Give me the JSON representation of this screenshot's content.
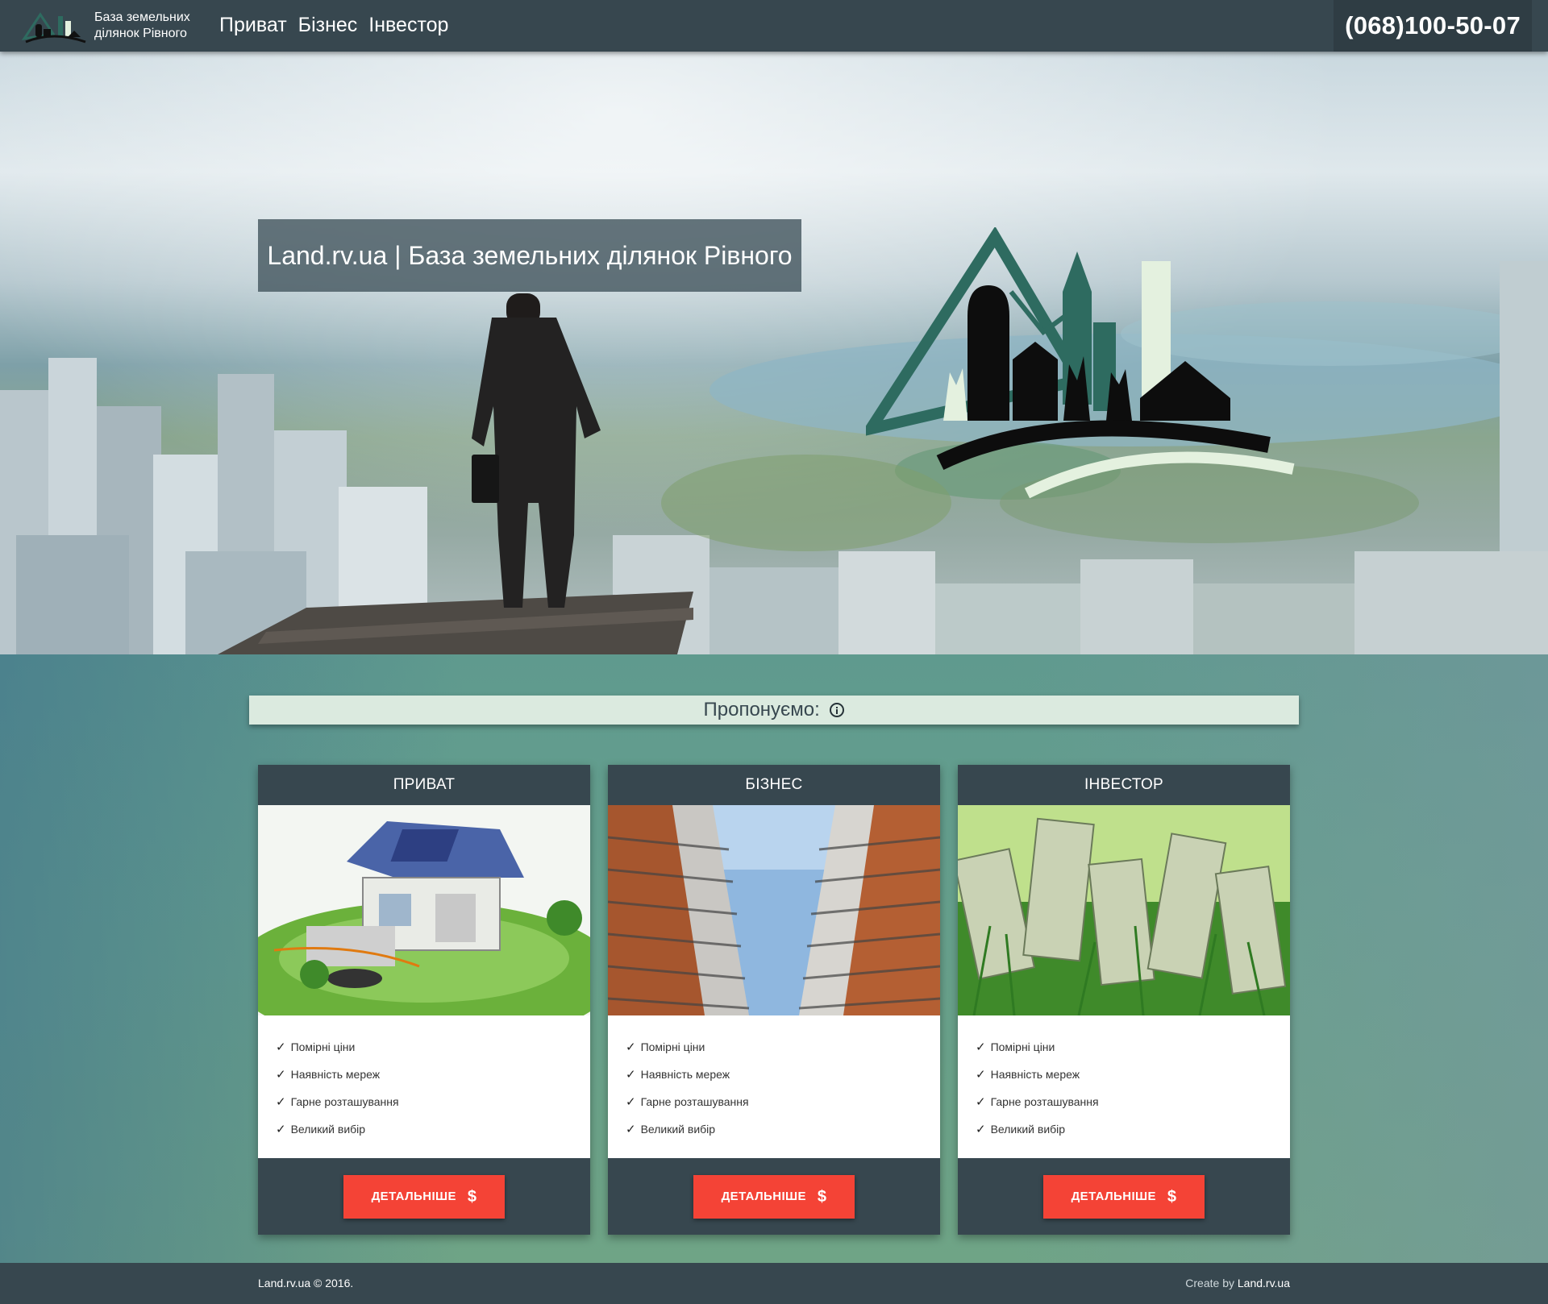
{
  "nav": {
    "brand_line1": "База земельних",
    "brand_line2": "ділянок Рівного",
    "links": [
      "Приват",
      "Бізнес",
      "Інвестор"
    ],
    "phone": "(068)100-50-07"
  },
  "hero": {
    "title": "Land.rv.ua | База земельних ділянок Рівного"
  },
  "offers": {
    "heading": "Пропонуємо:",
    "cards": [
      {
        "title": "ПРИВАТ",
        "features": [
          "Помірні ціни",
          "Наявність мереж",
          "Гарне розташування",
          "Великий вибір"
        ],
        "button": "ДЕТАЛЬНІШЕ"
      },
      {
        "title": "БІЗНЕС",
        "features": [
          "Помірні ціни",
          "Наявність мереж",
          "Гарне розташування",
          "Великий вибір"
        ],
        "button": "ДЕТАЛЬНІШЕ"
      },
      {
        "title": "ІНВЕСТОР",
        "features": [
          "Помірні ціни",
          "Наявність мереж",
          "Гарне розташування",
          "Великий вибір"
        ],
        "button": "ДЕТАЛЬНІШЕ"
      }
    ]
  },
  "footer": {
    "copyright": "Land.rv.ua © 2016.",
    "credit_prefix": "Create by",
    "credit_link": "Land.rv.ua"
  },
  "colors": {
    "navbar": "#37474f",
    "accent_button": "#f44336",
    "offer_bar": "#dbeadf",
    "logo_green": "#2e6b60",
    "logo_light": "#e4f1df"
  },
  "icons": [
    "info-icon",
    "check-icon",
    "dollar-icon"
  ]
}
